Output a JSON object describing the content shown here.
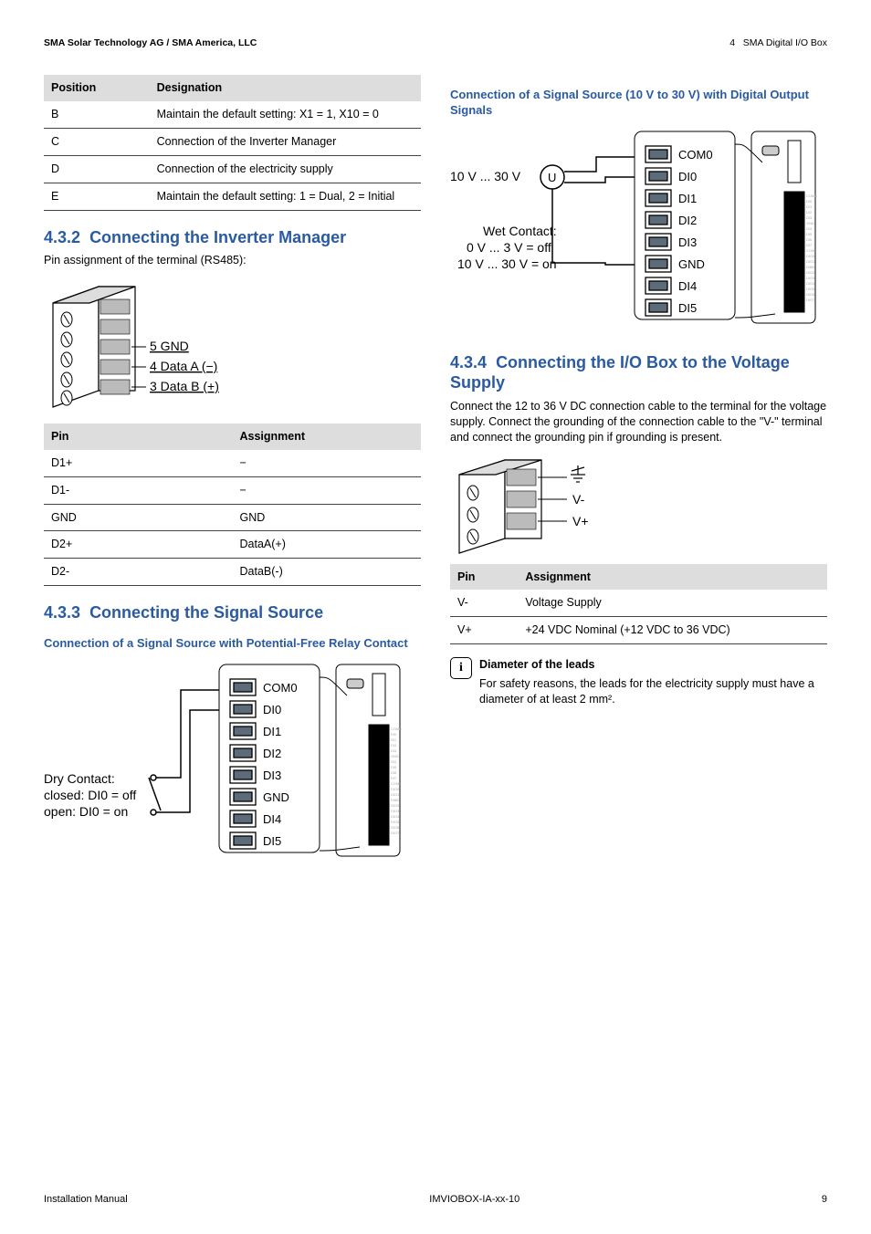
{
  "header": {
    "company": "SMA Solar Technology AG / SMA America, LLC",
    "section_num": "4",
    "section_title": "SMA Digital I/O Box"
  },
  "left": {
    "table1": {
      "headers": [
        "Position",
        "Designation"
      ],
      "rows": [
        [
          "B",
          "Maintain the default setting: X1 = 1, X10 = 0"
        ],
        [
          "C",
          "Connection of the Inverter Manager"
        ],
        [
          "D",
          "Connection of the electricity supply"
        ],
        [
          "E",
          "Maintain the default setting: 1 = Dual, 2 = Initial"
        ]
      ]
    },
    "sec432": {
      "num": "4.3.2",
      "title": "Connecting the Inverter Manager",
      "intro": "Pin assignment of the terminal (RS485):",
      "fig_labels": {
        "l5": "5 GND",
        "l4": "4 Data A (−)",
        "l3": "3 Data B (+)"
      },
      "table": {
        "headers": [
          "Pin",
          "Assignment"
        ],
        "rows": [
          [
            "D1+",
            "−"
          ],
          [
            "D1-",
            "−"
          ],
          [
            "GND",
            "GND"
          ],
          [
            "D2+",
            "DataA(+)"
          ],
          [
            "D2-",
            "DataB(-)"
          ]
        ]
      }
    },
    "sec433": {
      "num": "4.3.3",
      "title": "Connecting the Signal Source",
      "sub1": "Connection of a Signal Source with Potential-Free Relay Contact",
      "fig1": {
        "dry": "Dry Contact:",
        "closed": "closed: DI0 = off",
        "open": "open: DI0 = on",
        "pins": [
          "COM0",
          "DI0",
          "DI1",
          "DI2",
          "DI3",
          "GND",
          "DI4",
          "DI5"
        ]
      }
    }
  },
  "right": {
    "sec433_sub2": {
      "title": "Connection of a Signal Source (10 V to 30 V) with Digital Output Signals",
      "voltage": "10 V ... 30 V",
      "wet": "Wet Contact:",
      "off": "0 V ... 3 V = off",
      "on": "10 V ... 30 V = on",
      "pins": [
        "COM0",
        "DI0",
        "DI1",
        "DI2",
        "DI3",
        "GND",
        "DI4",
        "DI5"
      ]
    },
    "sec434": {
      "num": "4.3.4",
      "title": "Connecting the I/O Box to the Voltage Supply",
      "body": "Connect the 12 to 36 V DC connection cable to the terminal for the voltage supply. Connect the grounding of the connection cable to the \"V-\" terminal and connect the grounding pin if grounding is present.",
      "fig_labels": {
        "gnd": "⏚",
        "vminus": "V-",
        "vplus": "V+"
      },
      "table": {
        "headers": [
          "Pin",
          "Assignment"
        ],
        "rows": [
          [
            "V-",
            "Voltage Supply"
          ],
          [
            "V+",
            "+24 VDC Nominal (+12 VDC to 36 VDC)"
          ]
        ]
      },
      "note": {
        "icon": "i",
        "title": "Diameter of the leads",
        "body": "For safety reasons, the leads for the electricity supply must have a diameter of at least 2 mm²."
      }
    }
  },
  "footer": {
    "left": "Installation Manual",
    "center": "IMVIOBOX-IA-xx-10",
    "right": "9"
  },
  "chart_data": [
    {
      "type": "table",
      "title": "Position / Designation",
      "columns": [
        "Position",
        "Designation"
      ],
      "rows": [
        [
          "B",
          "Maintain the default setting: X1 = 1, X10 = 0"
        ],
        [
          "C",
          "Connection of the Inverter Manager"
        ],
        [
          "D",
          "Connection of the electricity supply"
        ],
        [
          "E",
          "Maintain the default setting: 1 = Dual, 2 = Initial"
        ]
      ]
    },
    {
      "type": "table",
      "title": "RS485 Pin Assignment",
      "columns": [
        "Pin",
        "Assignment"
      ],
      "rows": [
        [
          "D1+",
          "−"
        ],
        [
          "D1-",
          "−"
        ],
        [
          "GND",
          "GND"
        ],
        [
          "D2+",
          "DataA(+)"
        ],
        [
          "D2-",
          "DataB(-)"
        ]
      ]
    },
    {
      "type": "table",
      "title": "Voltage Supply Pin Assignment",
      "columns": [
        "Pin",
        "Assignment"
      ],
      "rows": [
        [
          "V-",
          "Voltage Supply"
        ],
        [
          "V+",
          "+24 VDC Nominal (+12 VDC to 36 VDC)"
        ]
      ]
    }
  ]
}
